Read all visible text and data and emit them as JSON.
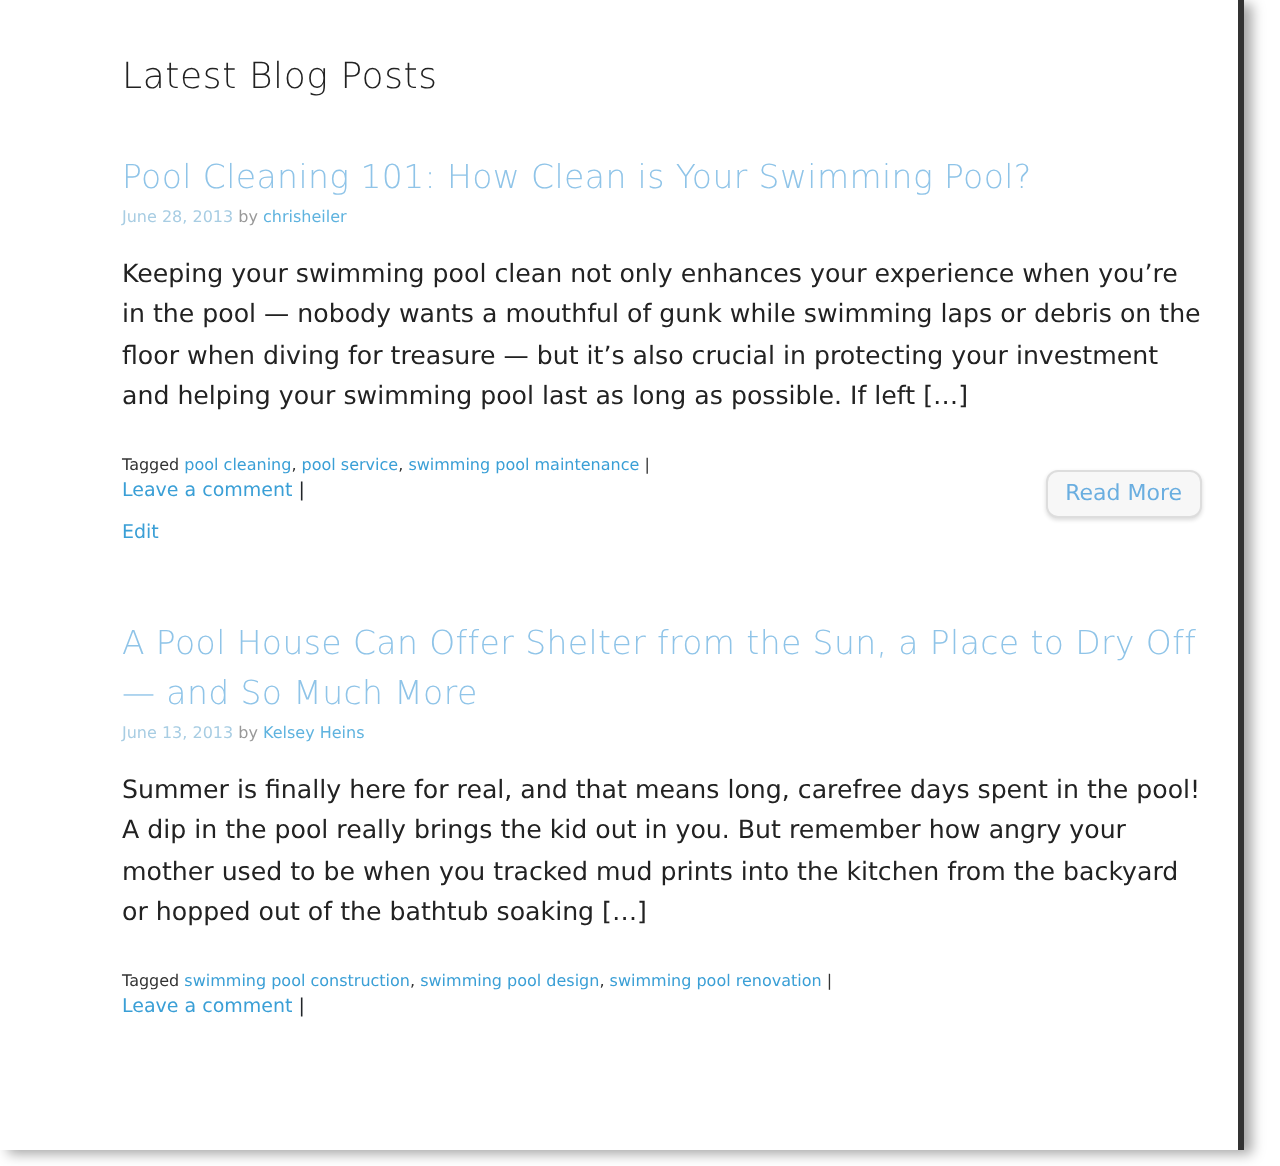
{
  "heading": "Latest Blog Posts",
  "posts": [
    {
      "title": "Pool Cleaning 101: How Clean is Your Swimming Pool?",
      "date": "June 28, 2013",
      "by": "by",
      "author": "chrisheiler",
      "excerpt": "Keeping your swimming pool clean not only enhances your experience when you’re in the pool — nobody wants a mouthful of gunk while swimming laps or debris on the floor when diving for treasure — but it’s also crucial in protecting your investment and helping your swimming pool last as long as possible. If left […]",
      "tagged": "Tagged",
      "tags": [
        "pool cleaning",
        "pool service",
        "swimming pool maintenance"
      ],
      "tag_separator": ",",
      "divider": "|",
      "comment_divider": "|",
      "comment": "Leave a comment",
      "edit": "Edit",
      "read_more": "Read More"
    },
    {
      "title": "A Pool House Can Offer Shelter from the Sun, a Place to Dry Off — and So Much More",
      "date": "June 13, 2013",
      "by": "by",
      "author": "Kelsey Heins",
      "excerpt": "Summer is finally here for real, and that means long, carefree days spent in the pool! A dip in the pool really brings the kid out in you. But remember how angry your mother used to be when you tracked mud prints into the kitchen from the backyard or hopped out of the bathtub soaking […]",
      "tagged": "Tagged",
      "tags": [
        "swimming pool construction",
        "swimming pool design",
        "swimming pool renovation"
      ],
      "tag_separator": ",",
      "divider": "|",
      "comment_divider": "|",
      "comment": "Leave a comment"
    }
  ]
}
